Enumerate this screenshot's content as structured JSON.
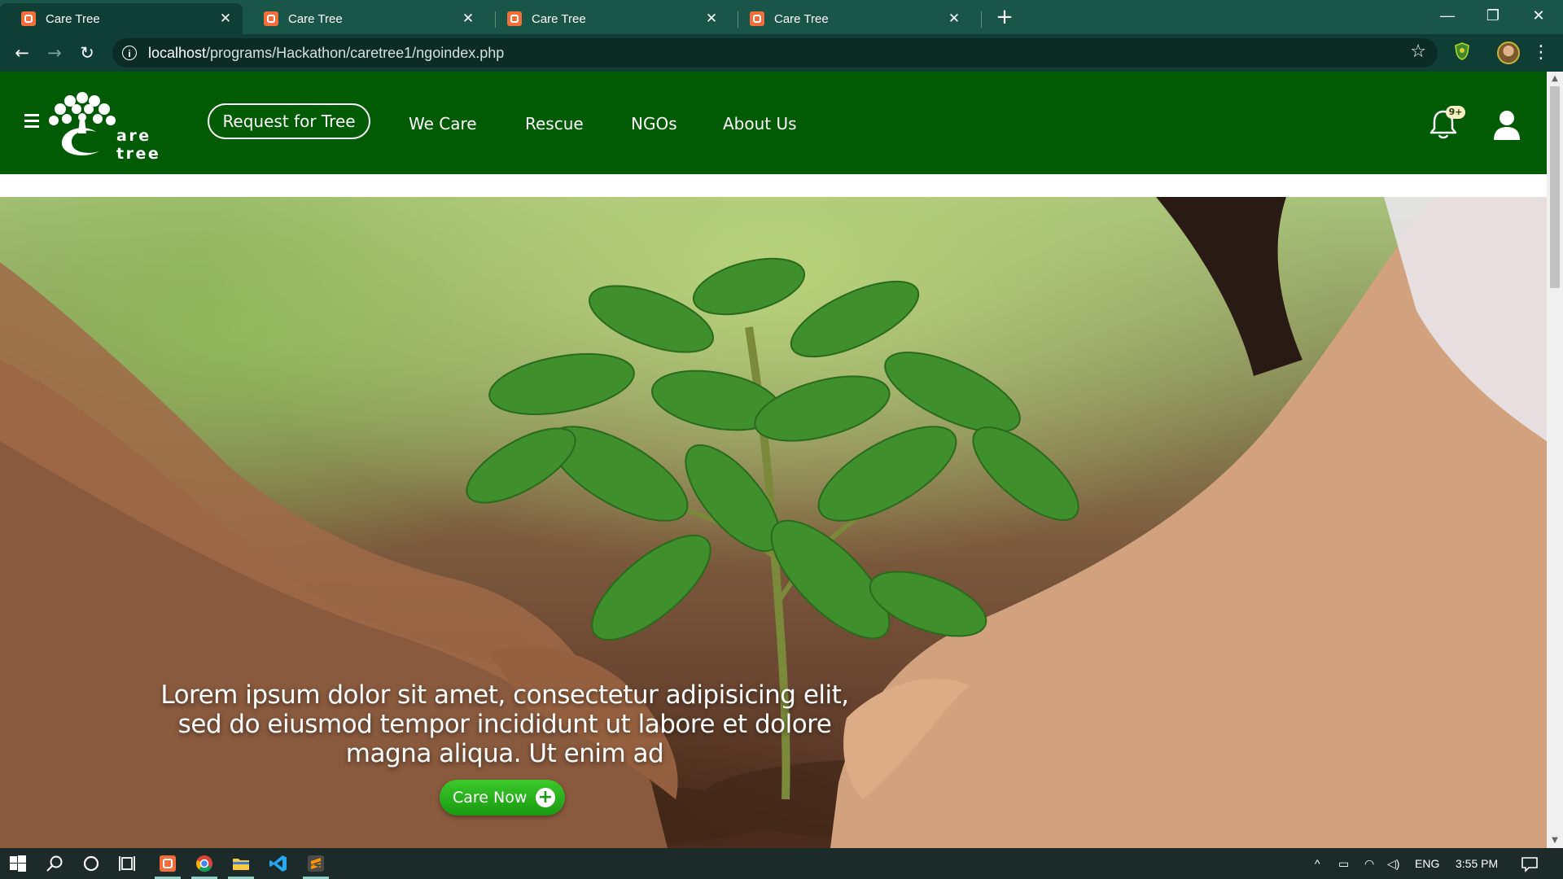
{
  "browser": {
    "tabs": [
      {
        "title": "Care Tree",
        "active": true
      },
      {
        "title": "Care Tree",
        "active": false
      },
      {
        "title": "Care Tree",
        "active": false
      },
      {
        "title": "Care Tree",
        "active": false
      }
    ],
    "new_tab_glyph": "+",
    "url_host": "localhost",
    "url_path": "/programs/Hackathon/caretree1/ngoindex.php",
    "window_controls": {
      "minimize": "—",
      "restore": "❐",
      "close": "✕"
    }
  },
  "site": {
    "brand": "are tree",
    "request_button": "Request for Tree",
    "nav": [
      "We Care",
      "Rescue",
      "NGOs",
      "About Us"
    ],
    "notification_badge": "9+",
    "header_color": "#005b04"
  },
  "hero": {
    "text": "Lorem ipsum dolor sit amet, consectetur adipisicing elit, sed do eiusmod tempor incididunt ut labore et dolore magna aliqua. Ut enim ad",
    "cta": "Care Now",
    "cta_color": "#22b01a"
  },
  "taskbar": {
    "language": "ENG",
    "time": "3:55 PM",
    "icons": [
      "windows-start-icon",
      "search-icon",
      "cortana-icon",
      "task-view-icon",
      "xampp-icon",
      "chrome-icon",
      "file-explorer-icon",
      "vscode-icon",
      "sublime-text-icon"
    ]
  }
}
